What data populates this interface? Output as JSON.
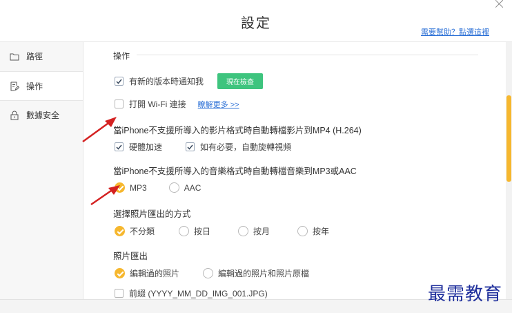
{
  "window": {
    "title": "設定",
    "help_link": "需要幫助？點選這裡"
  },
  "sidebar": {
    "items": [
      {
        "label": "路徑",
        "icon": "folder-icon"
      },
      {
        "label": "操作",
        "icon": "document-edit-icon"
      },
      {
        "label": "數據安全",
        "icon": "lock-icon"
      }
    ],
    "active_index": 1
  },
  "content": {
    "section_title": "操作",
    "notify_new_version": {
      "label": "有新的版本時通知我",
      "checked": true
    },
    "check_now_button": "現在檢查",
    "open_wifi": {
      "label": "打開 Wi-Fi 連接",
      "checked": false
    },
    "learn_more_link": "瞭解更多 >>",
    "video_group": {
      "title": "當iPhone不支援所導入的影片格式時自動轉檔影片到MP4 (H.264)",
      "hardware_accel": {
        "label": "硬體加速",
        "checked": true
      },
      "auto_rotate": {
        "label": "如有必要，自動旋轉視頻",
        "checked": true
      }
    },
    "music_group": {
      "title": "當iPhone不支援所導入的音樂格式時自動轉檔音樂到MP3或AAC",
      "options": [
        "MP3",
        "AAC"
      ],
      "selected": "MP3"
    },
    "photo_export_method": {
      "title": "選擇照片匯出的方式",
      "options": [
        "不分類",
        "按日",
        "按月",
        "按年"
      ],
      "selected": "不分類"
    },
    "photo_export": {
      "title": "照片匯出",
      "options": [
        "編輯過的照片",
        "編輯過的照片和照片原檔"
      ],
      "selected": "編輯過的照片",
      "prefix": {
        "label": "前綴 (YYYY_MM_DD_IMG_001.JPG)",
        "checked": false
      }
    }
  },
  "watermark": "最需教育",
  "colors": {
    "accent": "#f6b72e",
    "button_green": "#3ec47e",
    "link_blue": "#2a6fd6",
    "arrow_red": "#d42121"
  }
}
